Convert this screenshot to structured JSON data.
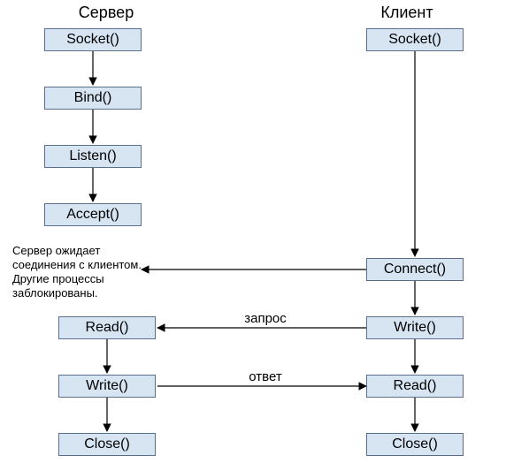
{
  "headings": {
    "server": "Сервер",
    "client": "Клиент"
  },
  "server_nodes": {
    "socket": "Socket()",
    "bind": "Bind()",
    "listen": "Listen()",
    "accept": "Accept()",
    "read": "Read()",
    "write": "Write()",
    "close": "Close()"
  },
  "client_nodes": {
    "socket": "Socket()",
    "connect": "Connect()",
    "write": "Write()",
    "read": "Read()",
    "close": "Close()"
  },
  "note": {
    "line1": "Сервер ожидает",
    "line2": "соединения с клиентом.",
    "line3": "Другие процессы",
    "line4": "заблокированы."
  },
  "edge_labels": {
    "request": "запрос",
    "response": "ответ"
  },
  "colors": {
    "box_fill": "#d7e4f2",
    "box_border": "#5b6f8c",
    "arrow": "#000000"
  }
}
